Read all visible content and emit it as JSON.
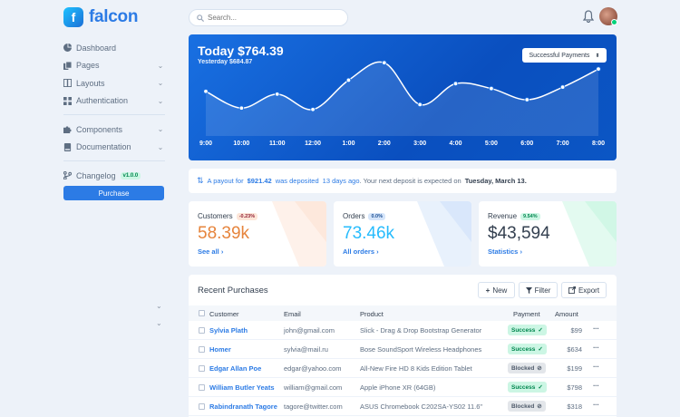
{
  "app": {
    "logo_text": "falcon",
    "logo_mark": "f"
  },
  "sidebar": {
    "items": [
      {
        "label": "Dashboard",
        "icon": "pie-chart-icon",
        "has_chevron": false
      },
      {
        "label": "Pages",
        "icon": "copy-icon",
        "has_chevron": true
      },
      {
        "label": "Layouts",
        "icon": "columns-icon",
        "has_chevron": true
      },
      {
        "label": "Authentication",
        "icon": "lock-icon",
        "has_chevron": true
      },
      {
        "label": "Components",
        "icon": "puzzle-icon",
        "has_chevron": true
      },
      {
        "label": "Documentation",
        "icon": "book-icon",
        "has_chevron": true
      },
      {
        "label": "Changelog",
        "icon": "code-branch-icon",
        "has_chevron": false,
        "badge": "v1.0.0"
      }
    ],
    "purchase_label": "Purchase"
  },
  "topbar": {
    "search_placeholder": "Search..."
  },
  "hero": {
    "title": "Today $764.39",
    "subtitle": "Yesterday $684.87",
    "select_value": "Successful Payments",
    "x_ticks": [
      "9:00",
      "10:00",
      "11:00",
      "12:00",
      "1:00",
      "2:00",
      "3:00",
      "4:00",
      "5:00",
      "6:00",
      "7:00",
      "8:00"
    ]
  },
  "chart_data": {
    "type": "line",
    "categories": [
      "9:00",
      "10:00",
      "11:00",
      "12:00",
      "1:00",
      "2:00",
      "3:00",
      "4:00",
      "5:00",
      "6:00",
      "7:00",
      "8:00"
    ],
    "series": [
      {
        "values": [
          64,
          40,
          60,
          38,
          80,
          105,
          45,
          75,
          68,
          52,
          70,
          96
        ]
      }
    ],
    "ylim": [
      0,
      130
    ],
    "grid": false,
    "line_color": "#ffffff"
  },
  "payout": {
    "prefix": "A payout for",
    "amount": "$921.42",
    "middle": "was deposited",
    "when": "13 days ago",
    "suffix": ". Your next deposit is expected on",
    "next_date": "Tuesday, March 13."
  },
  "stats": [
    {
      "label": "Customers",
      "badge": "-0.23%",
      "badge_bg": "#fde6d8",
      "badge_color": "#932338",
      "value": "58.39k",
      "value_color": "#e6843c",
      "link": "See all",
      "corner_color": "#fde6d8"
    },
    {
      "label": "Orders",
      "badge": "0.0%",
      "badge_bg": "#d5e5fa",
      "badge_color": "#1c4f93",
      "value": "73.46k",
      "value_color": "#27bcfd",
      "link": "All orders",
      "corner_color": "#d5e5fa"
    },
    {
      "label": "Revenue",
      "badge": "9.54%",
      "badge_bg": "#ccf6e4",
      "badge_color": "#00864e",
      "value": "$43,594",
      "value_color": "#344050",
      "link": "Statistics",
      "corner_color": "#ccf6e4"
    }
  ],
  "purchases": {
    "title": "Recent Purchases",
    "buttons": {
      "new": "New",
      "filter": "Filter",
      "export": "Export"
    },
    "columns": [
      "Customer",
      "Email",
      "Product",
      "Payment",
      "Amount"
    ],
    "rows": [
      {
        "customer": "Sylvia Plath",
        "email": "john@gmail.com",
        "product": "Slick - Drag & Drop Bootstrap Generator",
        "payment": "Success",
        "status": "success",
        "amount": "$99"
      },
      {
        "customer": "Homer",
        "email": "sylvia@mail.ru",
        "product": "Bose SoundSport Wireless Headphones",
        "payment": "Success",
        "status": "success",
        "amount": "$634"
      },
      {
        "customer": "Edgar Allan Poe",
        "email": "edgar@yahoo.com",
        "product": "All-New Fire HD 8 Kids Edition Tablet",
        "payment": "Blocked",
        "status": "blocked",
        "amount": "$199"
      },
      {
        "customer": "William Butler Yeats",
        "email": "william@gmail.com",
        "product": "Apple iPhone XR (64GB)",
        "payment": "Success",
        "status": "success",
        "amount": "$798"
      },
      {
        "customer": "Rabindranath Tagore",
        "email": "tagore@twitter.com",
        "product": "ASUS Chromebook C202SA-YS02 11.6\"",
        "payment": "Blocked",
        "status": "blocked",
        "amount": "$318"
      }
    ]
  }
}
